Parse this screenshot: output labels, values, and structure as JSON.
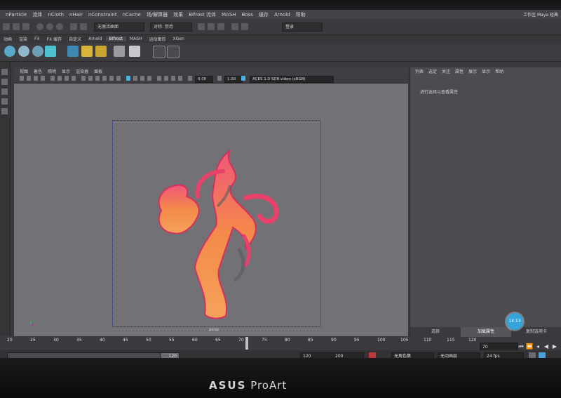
{
  "menubar": {
    "items": [
      "nParticle",
      "流体",
      "nCloth",
      "nHair",
      "nConstraint",
      "nCache",
      "场/解算器",
      "效果",
      "Bifrost 流体",
      "MASH",
      "Boss",
      "缓存",
      "Arnold",
      "帮助"
    ],
    "workspace_label": "工作区",
    "workspace_value": "Maya 经典"
  },
  "statusline": {
    "object_dropdown": "无激活曲面",
    "symmetry_dropdown": "对称: 禁用",
    "login_dropdown": "登录"
  },
  "shelf": {
    "tabs": [
      "动画",
      "渲染",
      "FX",
      "FX 缓存",
      "自定义",
      "Arnold",
      "Bifrost",
      "MASH",
      "运动图形",
      "XGen"
    ],
    "active_tab": "Bifrost"
  },
  "viewport": {
    "menu": [
      "视图",
      "着色",
      "照明",
      "显示",
      "渲染器",
      "面板"
    ],
    "field_a": "0.00",
    "field_b": "1.00",
    "color_space": "ACES 1.0 SDR-video (sRGB)",
    "camera_label": "persp"
  },
  "right_panel": {
    "menu": [
      "列表",
      "选定",
      "关注",
      "属性",
      "展示",
      "显示",
      "帮助"
    ],
    "empty_message": "进行选择以查看属性",
    "tabs": [
      "通道盒/层编辑器",
      "建模工具包",
      "属性编辑器"
    ],
    "visible_tabs": [
      "选择",
      "加载属性",
      "复制选项卡"
    ],
    "active_tab": "加载属性"
  },
  "badge": {
    "time": "14:13"
  },
  "timeline": {
    "ticks": [
      "20",
      "25",
      "30",
      "35",
      "40",
      "45",
      "50",
      "55",
      "60",
      "65",
      "70",
      "75",
      "80",
      "85",
      "90",
      "95",
      "100",
      "105",
      "110",
      "115",
      "120"
    ],
    "current_frame": "70"
  },
  "range": {
    "start_field": "120",
    "end_field": "120",
    "max_field": "200",
    "character_set": "无角色集",
    "anim_layer": "无动画层",
    "fps": "24 fps"
  },
  "monitor": {
    "brand_a": "ASUS",
    "brand_b": "ProArt"
  }
}
